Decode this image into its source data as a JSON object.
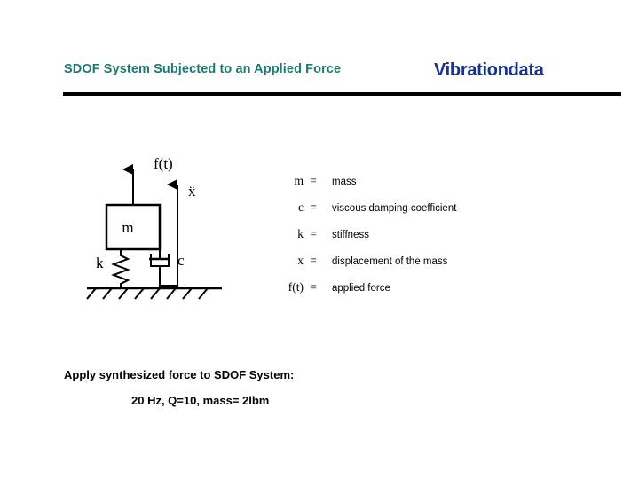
{
  "header": {
    "title": "SDOF System Subjected to an Applied Force",
    "brand": "Vibrationdata",
    "title_color": "#1d7a70",
    "brand_color": "#16348c",
    "rule_color": "#000000"
  },
  "diagram": {
    "name": "sdof-system-schematic",
    "force_label": "f(t)",
    "acceleration_label": "ẍ",
    "mass_label": "m",
    "spring_label": "k",
    "damper_label": "c"
  },
  "legend": {
    "rows": [
      {
        "symbol": "m",
        "equals": "=",
        "description": "mass"
      },
      {
        "symbol": "c",
        "equals": "=",
        "description": "viscous damping coefficient"
      },
      {
        "symbol": "k",
        "equals": "=",
        "description": "stiffness"
      },
      {
        "symbol": "x",
        "equals": "=",
        "description": "displacement of the mass"
      },
      {
        "symbol": "f(t)",
        "equals": "=",
        "description": "applied force"
      }
    ]
  },
  "notes": {
    "heading": "Apply synthesized force to SDOF System:",
    "parameters": "20 Hz,  Q=10,  mass= 2lbm"
  }
}
